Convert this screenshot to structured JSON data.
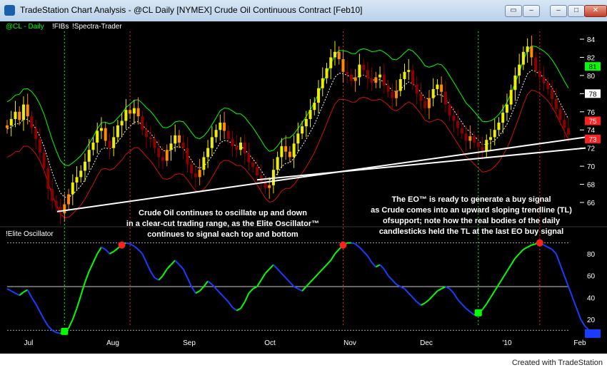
{
  "window": {
    "title": "TradeStation Chart Analysis - @CL  Daily [NYMEX] Crude Oil Continuous Contract [Feb10]",
    "min_label": "–",
    "max_label": "□",
    "close_label": "✕",
    "restore_label": "▭"
  },
  "chart": {
    "price_label_parts": [
      "@CL - Daily",
      "!FIBs",
      "!Spectra-Trader"
    ],
    "osc_label": "!Elite Oscillator",
    "footer": "Created with TradeStation",
    "annotation_left": [
      "Crude Oil continues to oscillate up and down",
      "in a clear-cut trading range, as the Elite Oscillator™",
      "continues to signal each top and bottom"
    ],
    "annotation_right": [
      "The EO™ is ready to generate a buy signal",
      "as Crude comes into an upward sloping trendline (TL)",
      "ofsupport; note how the real bodies of the daily",
      "candlesticks held the TL at the last EO buy signal"
    ],
    "colors": {
      "up": "#eeee00",
      "orange": "#ff8c00",
      "down": "#8b0000",
      "green_band": "#00ff00",
      "red_band": "#d01010",
      "osc_up": "#00ff00",
      "osc_down": "#1a3cff"
    }
  },
  "chart_data": [
    {
      "type": "candlestick",
      "title": "@CL - Daily",
      "x_tick_labels": [
        "Jul",
        "Aug",
        "Sep",
        "Oct",
        "Nov",
        "Dec",
        "'10",
        "Feb"
      ],
      "y_tick_labels": [
        66,
        68,
        70,
        72,
        74,
        76,
        78,
        80,
        82,
        84
      ],
      "ylim": [
        62,
        86
      ],
      "price_tags": [
        {
          "value": 81,
          "color": "#00ff00"
        },
        {
          "value": 78,
          "color": "#ffffff"
        },
        {
          "value": 75,
          "color": "#ff2020"
        },
        {
          "value": 73,
          "color": "#ff2020"
        }
      ],
      "close_values": [
        74.5,
        75.2,
        76.0,
        75.1,
        76.8,
        75.5,
        74.2,
        73.0,
        71.5,
        69.8,
        67.5,
        66.2,
        65.5,
        64.8,
        65.8,
        66.9,
        68.2,
        68.8,
        69.5,
        70.5,
        71.8,
        72.6,
        73.9,
        74.2,
        72.8,
        72.0,
        73.2,
        74.5,
        75.0,
        76.2,
        75.8,
        76.4,
        75.5,
        74.0,
        73.2,
        73.0,
        72.0,
        71.0,
        70.6,
        71.8,
        72.5,
        73.4,
        72.6,
        72.0,
        70.2,
        69.2,
        68.8,
        69.6,
        71.0,
        72.0,
        73.2,
        74.0,
        74.8,
        73.9,
        73.0,
        72.2,
        71.8,
        72.6,
        71.4,
        70.4,
        69.9,
        69.0,
        68.3,
        67.6,
        67.9,
        69.6,
        71.0,
        72.2,
        71.6,
        71.0,
        72.5,
        73.6,
        74.4,
        75.2,
        76.2,
        77.0,
        78.6,
        79.7,
        80.8,
        82.0,
        82.6,
        81.8,
        80.4,
        80.1,
        79.4,
        79.8,
        81.2,
        80.6,
        79.7,
        79.2,
        79.8,
        80.1,
        78.9,
        78.2,
        77.5,
        78.3,
        79.6,
        80.4,
        80.6,
        79.0,
        78.0,
        77.2,
        76.4,
        77.5,
        78.5,
        79.0,
        78.2,
        76.8,
        75.6,
        75.0,
        74.2,
        73.6,
        72.8,
        73.3,
        72.6,
        72.1,
        71.6,
        72.9,
        73.2,
        74.0,
        74.8,
        75.9,
        76.8,
        78.4,
        80.0,
        81.2,
        82.6,
        83.2,
        82.0,
        80.5,
        79.8,
        79.2,
        78.5,
        77.4,
        76.3,
        75.1,
        74.2,
        73.5
      ],
      "levels": {
        "top": 84.0,
        "tl_start": 65.0,
        "tl_end": 73.2
      }
    },
    {
      "type": "line",
      "title": "!Elite Oscillator",
      "y_tick_labels": [
        20,
        40,
        60,
        80
      ],
      "ylim": [
        0,
        100
      ],
      "reference_lines": [
        90,
        50,
        10
      ],
      "values": [
        48,
        46,
        44,
        42,
        45,
        47,
        40,
        34,
        27,
        20,
        14,
        10,
        8,
        7,
        9,
        12,
        20,
        30,
        42,
        54,
        64,
        72,
        80,
        86,
        84,
        80,
        82,
        85,
        88,
        90,
        89,
        87,
        84,
        80,
        72,
        64,
        58,
        56,
        60,
        66,
        70,
        74,
        70,
        66,
        58,
        50,
        44,
        46,
        50,
        55,
        52,
        48,
        44,
        40,
        36,
        31,
        28,
        30,
        36,
        44,
        48,
        50,
        56,
        62,
        66,
        70,
        66,
        62,
        58,
        54,
        50,
        48,
        46,
        50,
        54,
        58,
        62,
        66,
        70,
        74,
        80,
        84,
        88,
        90,
        90,
        89,
        86,
        82,
        78,
        72,
        68,
        70,
        66,
        60,
        56,
        52,
        50,
        48,
        44,
        40,
        36,
        33,
        35,
        38,
        42,
        46,
        48,
        50,
        48,
        44,
        38,
        34,
        30,
        27,
        24,
        26,
        29,
        34,
        40,
        46,
        52,
        58,
        64,
        70,
        76,
        80,
        84,
        86,
        88,
        89,
        90,
        88,
        86,
        84,
        80,
        70,
        60,
        50,
        40,
        30,
        20,
        14,
        10,
        7
      ]
    }
  ]
}
